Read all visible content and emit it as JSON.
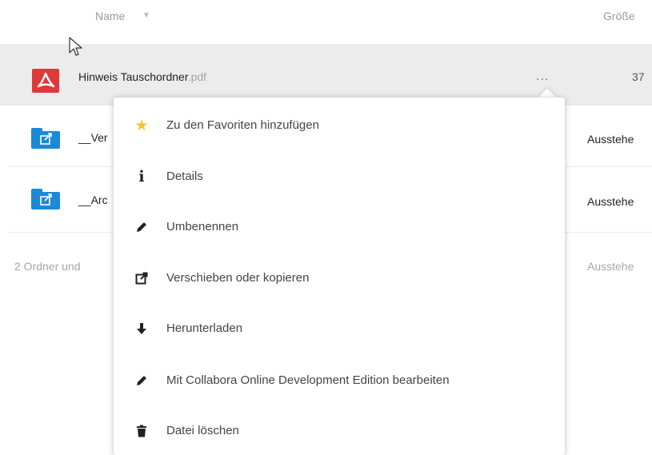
{
  "header": {
    "name_label": "Name",
    "sort_icon": "caret-down-icon",
    "size_label": "Größe"
  },
  "files": [
    {
      "base": "Hinweis Tauschordner",
      "ext": ".pdf",
      "icon": "pdf-icon",
      "size": "37",
      "actions_label": "..."
    },
    {
      "base": "__Ver",
      "icon": "shared-folder-icon",
      "status": "Ausstehe"
    },
    {
      "base": "__Arc",
      "icon": "shared-folder-icon",
      "status": "Ausstehe"
    }
  ],
  "summary": {
    "text": "2 Ordner und",
    "status": "Ausstehe"
  },
  "menu": {
    "items": [
      {
        "label": "Zu den Favoriten hinzufügen",
        "icon": "star-icon",
        "color": "#f2c230"
      },
      {
        "label": "Details",
        "icon": "info-icon"
      },
      {
        "label": "Umbenennen",
        "icon": "pencil-icon"
      },
      {
        "label": "Verschieben oder kopieren",
        "icon": "external-link-icon"
      },
      {
        "label": "Herunterladen",
        "icon": "download-arrow-icon"
      },
      {
        "label": "Mit Collabora Online Development Edition bearbeiten",
        "icon": "pencil-icon"
      },
      {
        "label": "Datei löschen",
        "icon": "trash-icon"
      }
    ]
  },
  "colors": {
    "pdf": "#e0383a",
    "folder": "#1a8ad6",
    "selected_row": "#ececec",
    "star": "#f2c230"
  }
}
